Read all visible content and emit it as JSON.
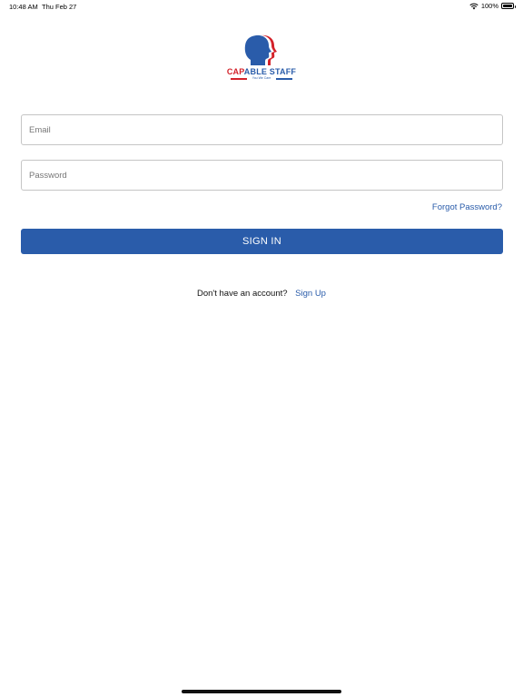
{
  "status_bar": {
    "time": "10:48 AM",
    "date": "Thu Feb 27",
    "battery": "100%",
    "icons": [
      "wifi-icon",
      "battery-icon"
    ]
  },
  "logo": {
    "text_part1": "CAP",
    "text_part2": "ABLE STAFF",
    "tagline": "You We Care",
    "colors": {
      "red": "#d3222a",
      "blue": "#2a5caa"
    }
  },
  "form": {
    "email_placeholder": "Email",
    "password_placeholder": "Password",
    "forgot_password": "Forgot Password?",
    "sign_in_label": "SIGN IN"
  },
  "signup": {
    "prompt": "Don't have an account?",
    "link": "Sign Up"
  },
  "colors": {
    "accent": "#2a5caa",
    "background": "#ffffff"
  }
}
